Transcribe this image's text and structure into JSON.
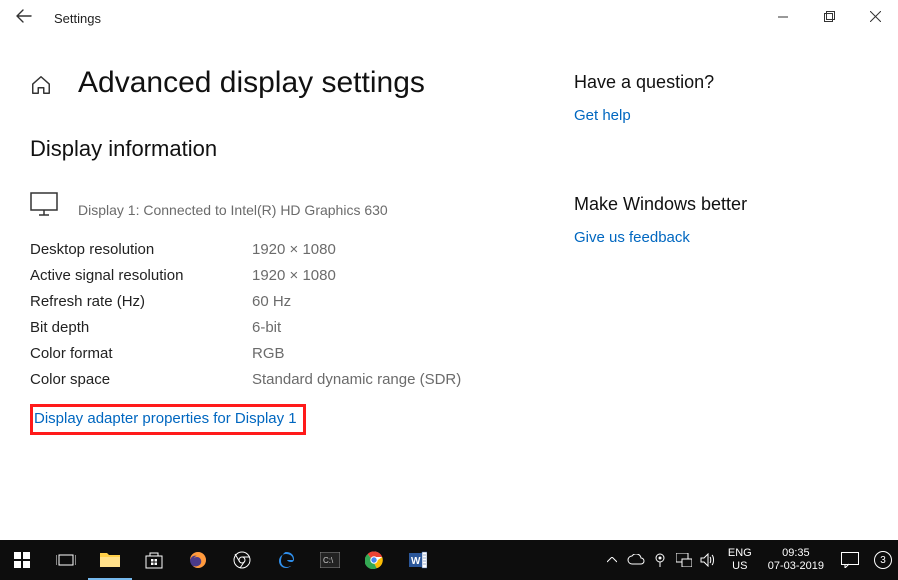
{
  "window": {
    "app_title": "Settings"
  },
  "page": {
    "title": "Advanced display settings",
    "section_title": "Display information",
    "display_label": "Display 1: Connected to Intel(R) HD Graphics 630",
    "props": [
      {
        "k": "Desktop resolution",
        "v": "1920 × 1080"
      },
      {
        "k": "Active signal resolution",
        "v": "1920 × 1080"
      },
      {
        "k": "Refresh rate (Hz)",
        "v": "60 Hz"
      },
      {
        "k": "Bit depth",
        "v": "6-bit"
      },
      {
        "k": "Color format",
        "v": "RGB"
      },
      {
        "k": "Color space",
        "v": "Standard dynamic range (SDR)"
      }
    ],
    "adapter_link": "Display adapter properties for Display 1"
  },
  "sidebar": {
    "question_heading": "Have a question?",
    "help_link": "Get help",
    "feedback_heading": "Make Windows better",
    "feedback_link": "Give us feedback"
  },
  "taskbar": {
    "lang1": "ENG",
    "lang2": "US",
    "time": "09:35",
    "date": "07-03-2019",
    "notif_count": "3"
  }
}
